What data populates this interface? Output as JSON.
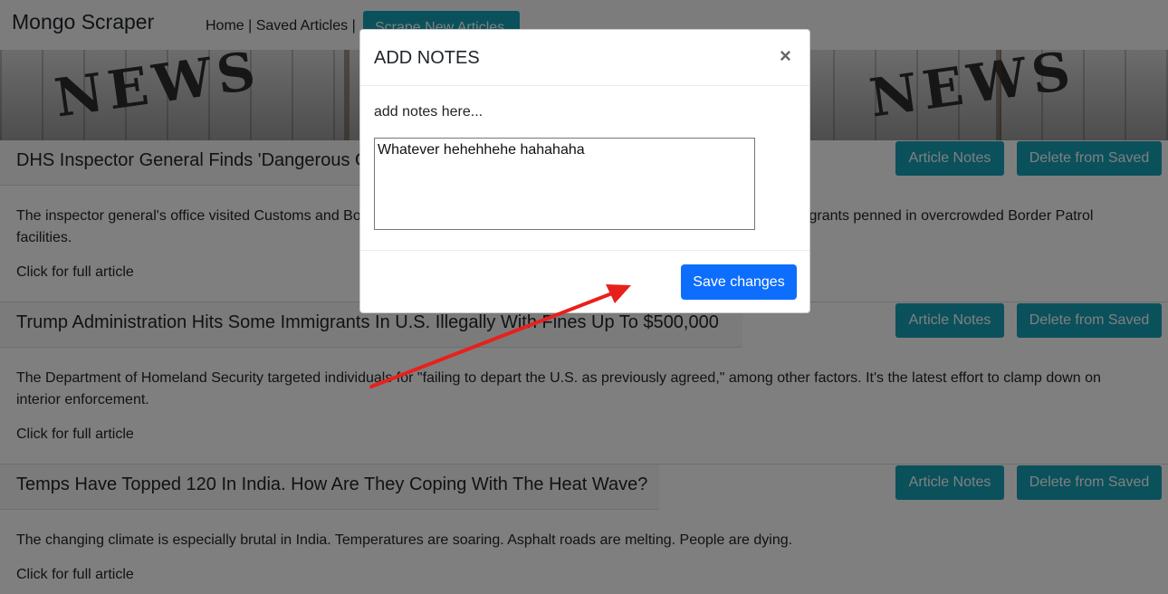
{
  "navbar": {
    "brand": "Mongo Scraper",
    "home_label": "Home",
    "sep1": " | ",
    "saved_label": "Saved Articles",
    "sep2": " |",
    "scrape_label": "Scrape New Articles"
  },
  "banner": {
    "word": "NEWS"
  },
  "articles": [
    {
      "title": "DHS Inspector General Finds 'Dangerous Overcrowding' At Border Patrol Facilities",
      "summary": "The inspector general's office visited Customs and Border Protection facilities in the Rio Grande Valley, where they found migrants penned in overcrowded Border Patrol facilities.",
      "link": "Click for full article",
      "notes_label": "Article Notes",
      "delete_label": "Delete from Saved"
    },
    {
      "title": "Trump Administration Hits Some Immigrants In U.S. Illegally With Fines Up To $500,000",
      "summary": "The Department of Homeland Security targeted individuals for \"failing to depart the U.S. as previously agreed,\" among other factors. It's the latest effort to clamp down on interior enforcement.",
      "link": "Click for full article",
      "notes_label": "Article Notes",
      "delete_label": "Delete from Saved"
    },
    {
      "title": "Temps Have Topped 120 In India. How Are They Coping With The Heat Wave?",
      "summary": "The changing climate is especially brutal in India. Temperatures are soaring. Asphalt roads are melting. People are dying.",
      "link": "Click for full article",
      "notes_label": "Article Notes",
      "delete_label": "Delete from Saved"
    }
  ],
  "modal": {
    "title": "ADD NOTES",
    "close_glyph": "×",
    "label": "add notes here...",
    "note_value": "Whatever hehehhehe hahahaha",
    "save_label": "Save changes"
  },
  "colors": {
    "accent": "#17a2b8",
    "primary": "#0d6efd",
    "arrow": "#e8201c"
  }
}
